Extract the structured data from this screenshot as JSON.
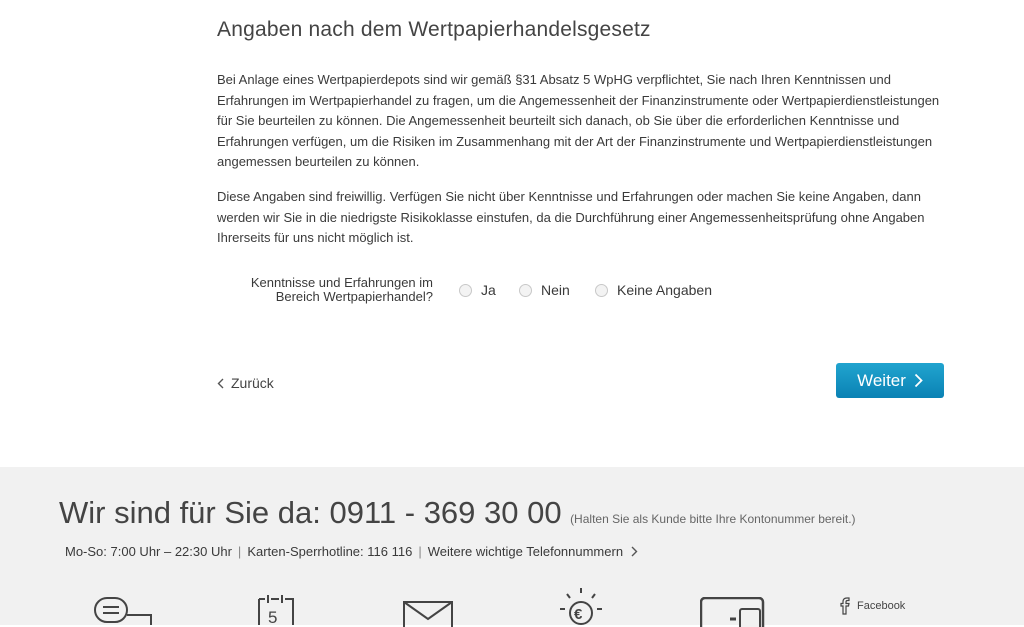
{
  "main": {
    "title": "Angaben nach dem Wertpapierhandelsgesetz",
    "paragraph1": "Bei Anlage eines Wertpapierdepots sind wir gemäß §31 Absatz 5 WpHG verpflichtet, Sie nach Ihren Kenntnissen und Erfahrungen im Wertpapierhandel zu fragen, um die Angemessenheit der Finanzinstrumente oder Wertpapierdienstleistungen für Sie beurteilen zu können. Die Angemessenheit beurteilt sich danach, ob Sie über die erforderlichen Kenntnisse und Erfahrungen verfügen, um die Risiken im Zusammenhang mit der Art der Finanzinstrumente und Wertpapierdienstleistungen angemessen beurteilen zu können.",
    "paragraph2": "Diese Angaben sind freiwillig. Verfügen Sie nicht über Kenntnisse und Erfahrungen oder machen Sie keine Angaben, dann werden wir Sie in die niedrigste Risikoklasse einstufen, da die Durchführung einer Angemessenheitsprüfung ohne Angaben Ihrerseits für uns nicht möglich ist.",
    "question": {
      "label_line1": "Kenntnisse und Erfahrungen im",
      "label_line2": "Bereich Wertpapierhandel?",
      "options": [
        "Ja",
        "Nein",
        "Keine Angaben"
      ],
      "selected": null
    },
    "back_label": "Zurück",
    "next_label": "Weiter"
  },
  "footer": {
    "headline": "Wir sind für Sie da: 0911 - 369 30 00",
    "headline_note": "(Halten Sie als Kunde bitte Ihre Kontonummer bereit.)",
    "hours": "Mo-So: 7:00 Uhr – 22:30 Uhr",
    "hotline": "Karten-Sperrhotline: 116 116",
    "phone_link": "Weitere wichtige Telefonnummern",
    "facebook": "Facebook",
    "icons": [
      "chat-icon",
      "calendar-icon",
      "mail-icon",
      "euro-idea-icon",
      "devices-icon",
      "facebook-icon"
    ],
    "calendar_number": "5",
    "euro_symbol": "€"
  },
  "colors": {
    "accent": "#0f8fc0",
    "footer_bg": "#f1f1f1",
    "text": "#3a3a3a"
  }
}
